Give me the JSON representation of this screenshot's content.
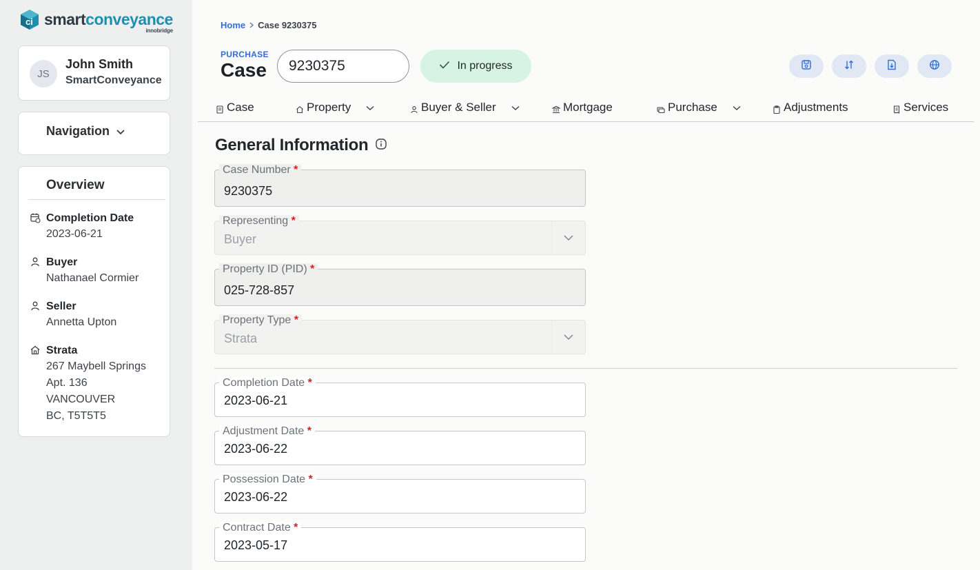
{
  "brand": {
    "name_part1": "smart",
    "name_part2": "conveyance",
    "sub": "innobridge",
    "mark_letter": "ci"
  },
  "user": {
    "initials": "JS",
    "name": "John Smith",
    "org": "SmartConveyance"
  },
  "navigation": {
    "label": "Navigation"
  },
  "overview": {
    "title": "Overview",
    "items": [
      {
        "icon": "calendar-icon",
        "label": "Completion Date",
        "lines": [
          "2023-06-21"
        ]
      },
      {
        "icon": "person-icon",
        "label": "Buyer",
        "lines": [
          "Nathanael Cormier"
        ]
      },
      {
        "icon": "person-icon",
        "label": "Seller",
        "lines": [
          "Annetta Upton"
        ]
      },
      {
        "icon": "home-icon",
        "label": "Strata",
        "lines": [
          "267 Maybell Springs",
          "Apt. 136",
          "VANCOUVER",
          "BC, T5T5T5"
        ]
      }
    ]
  },
  "breadcrumb": {
    "home": "Home",
    "current": "Case 9230375"
  },
  "header": {
    "kind": "PURCHASE",
    "title": "Case",
    "case_number": "9230375",
    "status": "In progress",
    "status_color": "#d7f3e3"
  },
  "toolbar": {
    "buttons": [
      {
        "name": "save-icon"
      },
      {
        "name": "sort-icon"
      },
      {
        "name": "file-download-icon"
      },
      {
        "name": "globe-icon"
      }
    ]
  },
  "tabs": [
    {
      "label": "Case",
      "icon": "document-icon",
      "dropdown": false
    },
    {
      "label": "Property",
      "icon": "home-icon",
      "dropdown": true
    },
    {
      "label": "Buyer & Seller",
      "icon": "person-icon",
      "dropdown": true
    },
    {
      "label": "Mortgage",
      "icon": "bank-icon",
      "dropdown": false
    },
    {
      "label": "Purchase",
      "icon": "money-icon",
      "dropdown": true
    },
    {
      "label": "Adjustments",
      "icon": "clipboard-icon",
      "dropdown": false
    },
    {
      "label": "Services",
      "icon": "receipt-icon",
      "dropdown": false
    }
  ],
  "section": {
    "title": "General Information"
  },
  "fields": {
    "case_number": {
      "label": "Case Number",
      "value": "9230375"
    },
    "representing": {
      "label": "Representing",
      "value": "Buyer"
    },
    "pid": {
      "label": "Property ID (PID)",
      "value": "025-728-857"
    },
    "property_type": {
      "label": "Property Type",
      "value": "Strata"
    },
    "completion_date": {
      "label": "Completion Date",
      "value": "2023-06-21"
    },
    "adjustment_date": {
      "label": "Adjustment Date",
      "value": "2023-06-22"
    },
    "possession_date": {
      "label": "Possession Date",
      "value": "2023-06-22"
    },
    "contract_date": {
      "label": "Contract Date",
      "value": "2023-05-17"
    }
  },
  "required_marker": "*",
  "colors": {
    "accent": "#2f6fd6",
    "brand_teal": "#1f8fb0",
    "required": "#d32020"
  }
}
